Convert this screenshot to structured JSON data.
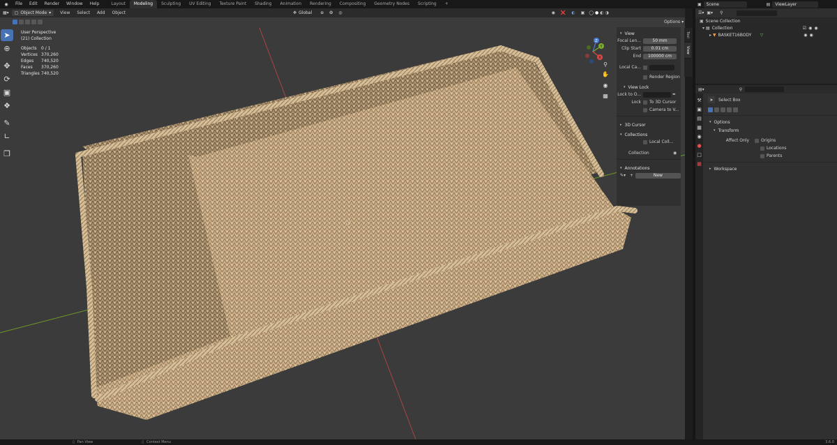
{
  "topbar": {
    "menus": [
      "File",
      "Edit",
      "Render",
      "Window",
      "Help"
    ],
    "workspaces": [
      "Layout",
      "Modeling",
      "Sculpting",
      "UV Editing",
      "Texture Paint",
      "Shading",
      "Animation",
      "Rendering",
      "Compositing",
      "Geometry Nodes",
      "Scripting",
      "+"
    ],
    "active_workspace": "Modeling",
    "scene_name": "Scene",
    "view_layer": "ViewLayer"
  },
  "viewport_header": {
    "mode": "Object Mode",
    "menus": [
      "View",
      "Select",
      "Add",
      "Object"
    ],
    "transform_orientation": "Global",
    "options_label": "Options"
  },
  "overlay": {
    "view_name": "User Perspective",
    "collection": "(21) Collection",
    "stats": [
      {
        "k": "Objects",
        "v": "0 / 1"
      },
      {
        "k": "Vertices",
        "v": "370,260"
      },
      {
        "k": "Edges",
        "v": "740,520"
      },
      {
        "k": "Faces",
        "v": "370,260"
      },
      {
        "k": "Triangles",
        "v": "740,520"
      }
    ]
  },
  "gizmo": {
    "z": "Z",
    "y": "Y",
    "x": "X"
  },
  "n_panel": {
    "view_title": "View",
    "focal_label": "Focal Len...",
    "focal_value": "50 mm",
    "clip_start_label": "Clip Start",
    "clip_start_value": "0.01 cm",
    "clip_end_label": "End",
    "clip_end_value": "100000 cm",
    "local_camera_label": "Local Ca...",
    "render_region": "Render Region",
    "view_lock_title": "View Lock",
    "lock_to_object_label": "Lock to O...",
    "lock_label": "Lock",
    "to_3d_cursor": "To 3D Cursor",
    "camera_to_view": "Camera to V...",
    "cursor_title": "3D Cursor",
    "collections_title": "Collections",
    "local_collections": "Local Coll...",
    "collection_item": "Collection",
    "annotations_title": "Annotations",
    "new_button": "New"
  },
  "side_tabs": [
    "Tool",
    "View"
  ],
  "outliner": {
    "scene_collection": "Scene Collection",
    "collection": "Collection",
    "object": "BASKET16BODY"
  },
  "properties": {
    "tool_name": "Select Box",
    "options": "Options",
    "transform": "Transform",
    "affect_only": "Affect Only",
    "origins": "Origins",
    "locations": "Locations",
    "parents": "Parents",
    "workspace": "Workspace"
  },
  "statusbar": {
    "pan_view": "Pan View",
    "context_menu": "Context Menu",
    "version": "3.6.0"
  },
  "colors": {
    "accent": "#4772b3",
    "viewport_bg": "#3b3b3b",
    "basket": "#cdb08a",
    "axis_x": "#a84646",
    "axis_y": "#6e9a2a"
  }
}
